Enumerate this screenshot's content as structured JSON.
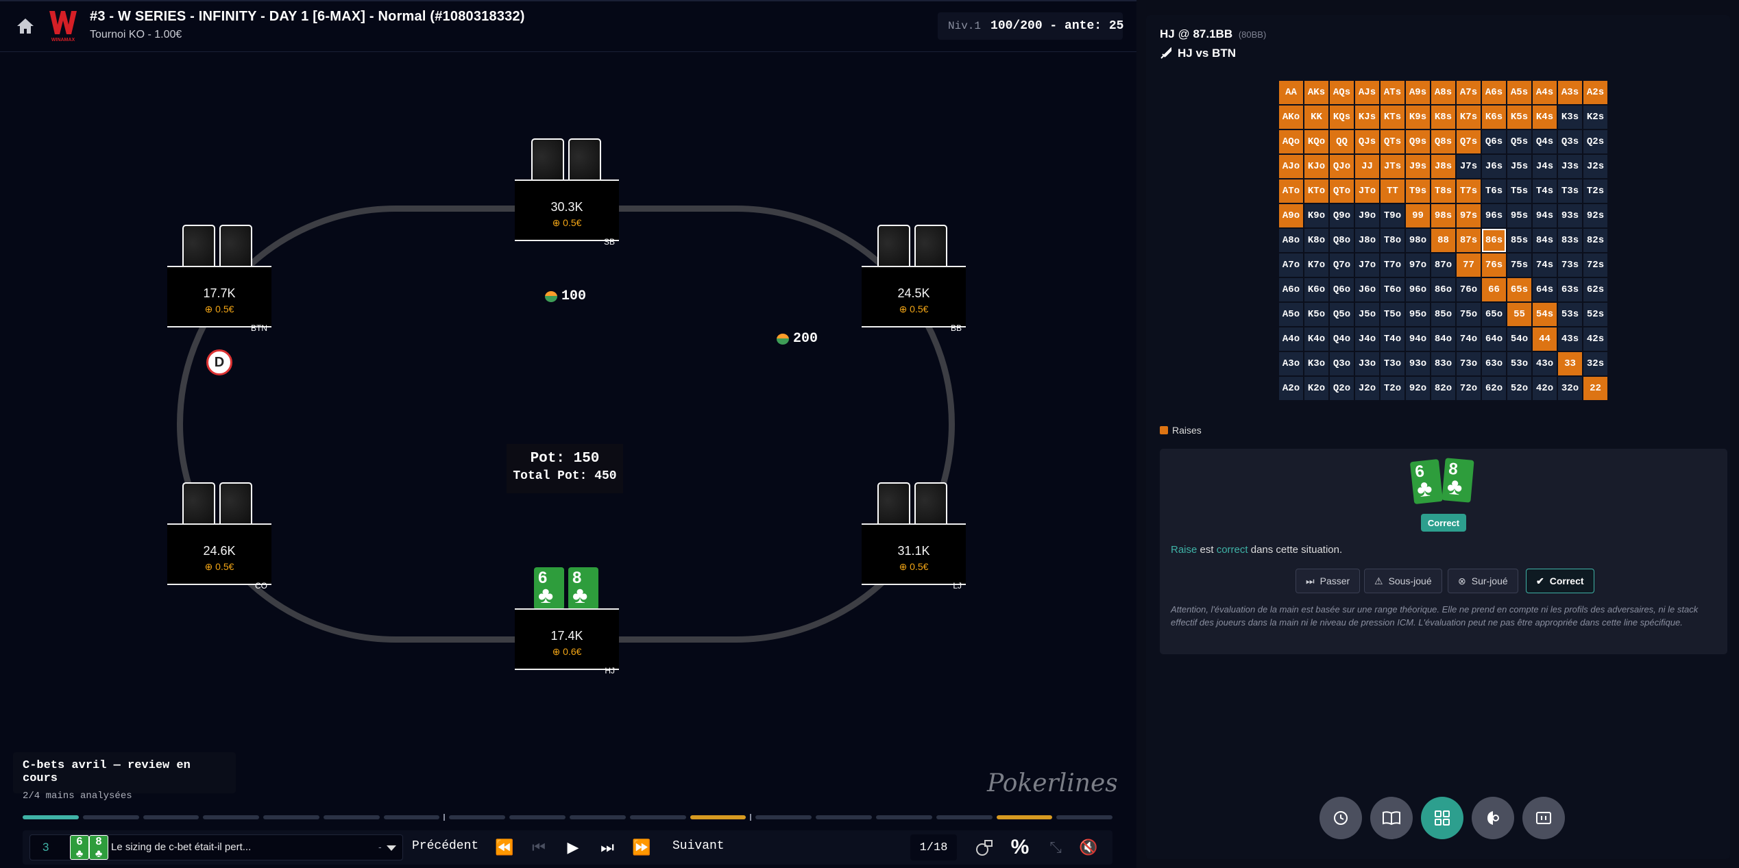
{
  "header": {
    "title": "#3 - W SERIES - INFINITY - DAY 1 [6-MAX] - Normal (#1080318332)",
    "subtitle": "Tournoi KO - 1.00€",
    "level_label": "Niv.1",
    "blinds": "100/200 - ante: 25",
    "logo_text": "WINAMAX",
    "colors": {
      "logo": "#d51f26",
      "accent": "#3fb2a6",
      "raise": "#dd7413"
    }
  },
  "table": {
    "seats": [
      {
        "id": "sb",
        "stack": "30.3K",
        "bounty": "⊕ 0.5€",
        "position": "SB",
        "cards": "hidden"
      },
      {
        "id": "btn",
        "stack": "17.7K",
        "bounty": "⊕ 0.5€",
        "position": "BTN",
        "cards": "hidden"
      },
      {
        "id": "bb",
        "stack": "24.5K",
        "bounty": "⊕ 0.5€",
        "position": "BB",
        "cards": "hidden"
      },
      {
        "id": "co",
        "stack": "24.6K",
        "bounty": "⊕ 0.5€",
        "position": "CO",
        "cards": "hidden"
      },
      {
        "id": "lj",
        "stack": "31.1K",
        "bounty": "⊕ 0.5€",
        "position": "LJ",
        "cards": "hidden"
      },
      {
        "id": "hj",
        "stack": "17.4K",
        "bounty": "⊕ 0.6€",
        "position": "HJ",
        "cards": "6♣ 8♣"
      }
    ],
    "hero_cards": [
      {
        "rank": "6",
        "suit": "♣"
      },
      {
        "rank": "8",
        "suit": "♣"
      }
    ],
    "dealer_button": "D",
    "bets": {
      "sb": "100",
      "bb": "200"
    },
    "pot": "Pot: 150",
    "total_pot": "Total Pot: 450"
  },
  "review": {
    "title": "C-bets avril — review en cours",
    "subtitle": "2/4 mains analysées"
  },
  "brand": "Pokerlines",
  "progress": {
    "segments": 18,
    "current": 1,
    "highlighted": [
      12,
      17
    ]
  },
  "controls": {
    "hand_number": "3",
    "hand_cards": [
      "6",
      "8"
    ],
    "hand_comment": "Le sizing de c-bet était-il pert...",
    "hand_dash": "-",
    "previous": "Précédent",
    "next": "Suivant",
    "counter": "1/18"
  },
  "analysis": {
    "player": "HJ",
    "at": "@",
    "stack_bb": "87.1BB",
    "effective_bb": "(80BB)",
    "matchup": "HJ vs BTN",
    "legend_raises": "Raises",
    "selected_hand": "86s",
    "range": [
      [
        "AA",
        "AKs",
        "AQs",
        "AJs",
        "ATs",
        "A9s",
        "A8s",
        "A7s",
        "A6s",
        "A5s",
        "A4s",
        "A3s",
        "A2s"
      ],
      [
        "AKo",
        "KK",
        "KQs",
        "KJs",
        "KTs",
        "K9s",
        "K8s",
        "K7s",
        "K6s",
        "K5s",
        "K4s",
        "K3s",
        "K2s"
      ],
      [
        "AQo",
        "KQo",
        "QQ",
        "QJs",
        "QTs",
        "Q9s",
        "Q8s",
        "Q7s",
        "Q6s",
        "Q5s",
        "Q4s",
        "Q3s",
        "Q2s"
      ],
      [
        "AJo",
        "KJo",
        "QJo",
        "JJ",
        "JTs",
        "J9s",
        "J8s",
        "J7s",
        "J6s",
        "J5s",
        "J4s",
        "J3s",
        "J2s"
      ],
      [
        "ATo",
        "KTo",
        "QTo",
        "JTo",
        "TT",
        "T9s",
        "T8s",
        "T7s",
        "T6s",
        "T5s",
        "T4s",
        "T3s",
        "T2s"
      ],
      [
        "A9o",
        "K9o",
        "Q9o",
        "J9o",
        "T9o",
        "99",
        "98s",
        "97s",
        "96s",
        "95s",
        "94s",
        "93s",
        "92s"
      ],
      [
        "A8o",
        "K8o",
        "Q8o",
        "J8o",
        "T8o",
        "98o",
        "88",
        "87s",
        "86s",
        "85s",
        "84s",
        "83s",
        "82s"
      ],
      [
        "A7o",
        "K7o",
        "Q7o",
        "J7o",
        "T7o",
        "97o",
        "87o",
        "77",
        "76s",
        "75s",
        "74s",
        "73s",
        "72s"
      ],
      [
        "A6o",
        "K6o",
        "Q6o",
        "J6o",
        "T6o",
        "96o",
        "86o",
        "76o",
        "66",
        "65s",
        "64s",
        "63s",
        "62s"
      ],
      [
        "A5o",
        "K5o",
        "Q5o",
        "J5o",
        "T5o",
        "95o",
        "85o",
        "75o",
        "65o",
        "55",
        "54s",
        "53s",
        "52s"
      ],
      [
        "A4o",
        "K4o",
        "Q4o",
        "J4o",
        "T4o",
        "94o",
        "84o",
        "74o",
        "64o",
        "54o",
        "44",
        "43s",
        "42s"
      ],
      [
        "A3o",
        "K3o",
        "Q3o",
        "J3o",
        "T3o",
        "93o",
        "83o",
        "73o",
        "63o",
        "53o",
        "43o",
        "33",
        "32s"
      ],
      [
        "A2o",
        "K2o",
        "Q2o",
        "J2o",
        "T2o",
        "92o",
        "82o",
        "72o",
        "62o",
        "52o",
        "42o",
        "32o",
        "22"
      ]
    ],
    "raise_hands": [
      "AA",
      "AKs",
      "AQs",
      "AJs",
      "ATs",
      "A9s",
      "A8s",
      "A7s",
      "A6s",
      "A5s",
      "A4s",
      "A3s",
      "A2s",
      "AKo",
      "KK",
      "KQs",
      "KJs",
      "KTs",
      "K9s",
      "K8s",
      "K7s",
      "K6s",
      "K5s",
      "K4s",
      "AQo",
      "KQo",
      "QQ",
      "QJs",
      "QTs",
      "Q9s",
      "Q8s",
      "Q7s",
      "AJo",
      "KJo",
      "QJo",
      "JJ",
      "JTs",
      "J9s",
      "J8s",
      "ATo",
      "KTo",
      "QTo",
      "JTo",
      "TT",
      "T9s",
      "T8s",
      "T7s",
      "A9o",
      "99",
      "98s",
      "97s",
      "88",
      "87s",
      "86s",
      "77",
      "76s",
      "66",
      "65s",
      "55",
      "54s",
      "44",
      "33",
      "22"
    ],
    "eval_badge": "Correct",
    "eval_word1": "Raise",
    "eval_mid": "est",
    "eval_word2": "correct",
    "eval_end": "dans cette situation.",
    "buttons": [
      {
        "id": "pass",
        "label": "Passer",
        "icon": "skip-icon"
      },
      {
        "id": "under",
        "label": "Sous-joué",
        "icon": "warning-icon"
      },
      {
        "id": "over",
        "label": "Sur-joué",
        "icon": "x-circle-icon"
      },
      {
        "id": "correct",
        "label": "Correct",
        "icon": "check-icon"
      }
    ],
    "disclaimer": "Attention, l'évaluation de la main est basée sur une range théorique. Elle ne prend en compte ni les profils des adversaires, ni le stack effectif des joueurs dans la main ni le niveau de pression ICM. L'évaluation peut ne pas être appropriée dans cette line spécifique."
  }
}
